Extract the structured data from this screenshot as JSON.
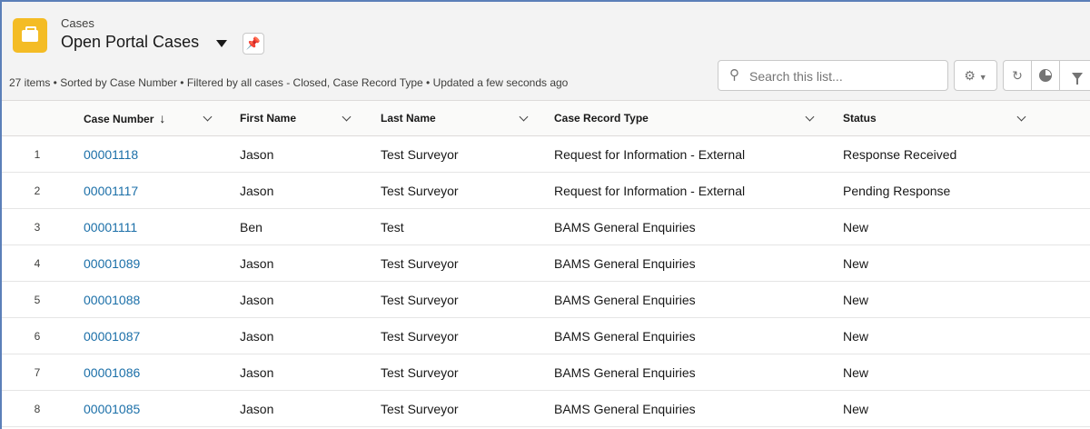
{
  "header": {
    "object_label": "Cases",
    "list_title": "Open Portal Cases",
    "summary": "27 items • Sorted by Case Number • Filtered by all cases - Closed, Case Record Type • Updated a few seconds ago"
  },
  "search": {
    "placeholder": "Search this list..."
  },
  "icons": {
    "object": "briefcase-icon",
    "pin": "pin-icon",
    "search": "search-icon",
    "settings": "gear-icon",
    "refresh": "refresh-icon",
    "chart": "pie-chart-icon",
    "filter": "filter-icon"
  },
  "colors": {
    "accent": "#f4bc25",
    "link": "#1b6fa8",
    "header_bg": "#f3f3f3"
  },
  "table": {
    "columns": [
      {
        "label": "Case Number",
        "sorted": "desc"
      },
      {
        "label": "First Name"
      },
      {
        "label": "Last Name"
      },
      {
        "label": "Case Record Type"
      },
      {
        "label": "Status"
      }
    ],
    "rows": [
      {
        "num": "1",
        "case_number": "00001118",
        "first_name": "Jason",
        "last_name": "Test Surveyor",
        "record_type": "Request for Information - External",
        "status": "Response Received"
      },
      {
        "num": "2",
        "case_number": "00001117",
        "first_name": "Jason",
        "last_name": "Test Surveyor",
        "record_type": "Request for Information - External",
        "status": "Pending Response"
      },
      {
        "num": "3",
        "case_number": "00001111",
        "first_name": "Ben",
        "last_name": "Test",
        "record_type": "BAMS General Enquiries",
        "status": "New"
      },
      {
        "num": "4",
        "case_number": "00001089",
        "first_name": "Jason",
        "last_name": "Test Surveyor",
        "record_type": "BAMS General Enquiries",
        "status": "New"
      },
      {
        "num": "5",
        "case_number": "00001088",
        "first_name": "Jason",
        "last_name": "Test Surveyor",
        "record_type": "BAMS General Enquiries",
        "status": "New"
      },
      {
        "num": "6",
        "case_number": "00001087",
        "first_name": "Jason",
        "last_name": "Test Surveyor",
        "record_type": "BAMS General Enquiries",
        "status": "New"
      },
      {
        "num": "7",
        "case_number": "00001086",
        "first_name": "Jason",
        "last_name": "Test Surveyor",
        "record_type": "BAMS General Enquiries",
        "status": "New"
      },
      {
        "num": "8",
        "case_number": "00001085",
        "first_name": "Jason",
        "last_name": "Test Surveyor",
        "record_type": "BAMS General Enquiries",
        "status": "New"
      }
    ]
  }
}
